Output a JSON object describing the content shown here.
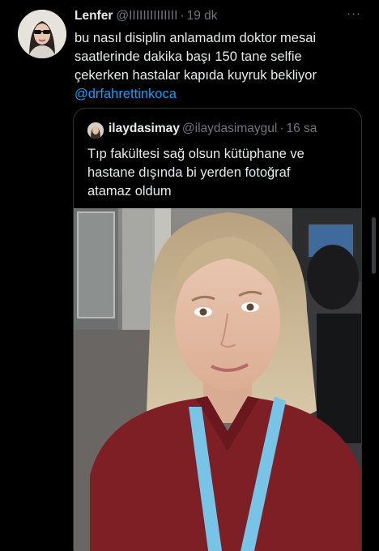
{
  "tweet": {
    "author_name": "Lenfer",
    "author_handle": "@IIIIIIIIIIIIII",
    "separator": "·",
    "time": "19 dk",
    "more_icon": "···",
    "text_lines": [
      "bu nasıl disiplin anlamadım doktor mesai",
      "saatlerinde dakika başı 150 tane selfie",
      "çekerken hastalar kapıda kuyruk bekliyor"
    ],
    "mention": "@drfahrettinkoca"
  },
  "quoted": {
    "author_name": "ilaydasimay",
    "author_handle": "@ilaydasimaygul",
    "separator": "·",
    "time": "16 sa",
    "text_lines": [
      "Tıp fakültesi sağ olsun kütüphane ve",
      "hastane dışında bi yerden fotoğraf",
      "atamaz oldum"
    ]
  },
  "colors": {
    "background": "#000000",
    "text": "#e7e9ea",
    "secondary": "#71767b",
    "link": "#1d9bf0",
    "border": "#2f3336"
  }
}
